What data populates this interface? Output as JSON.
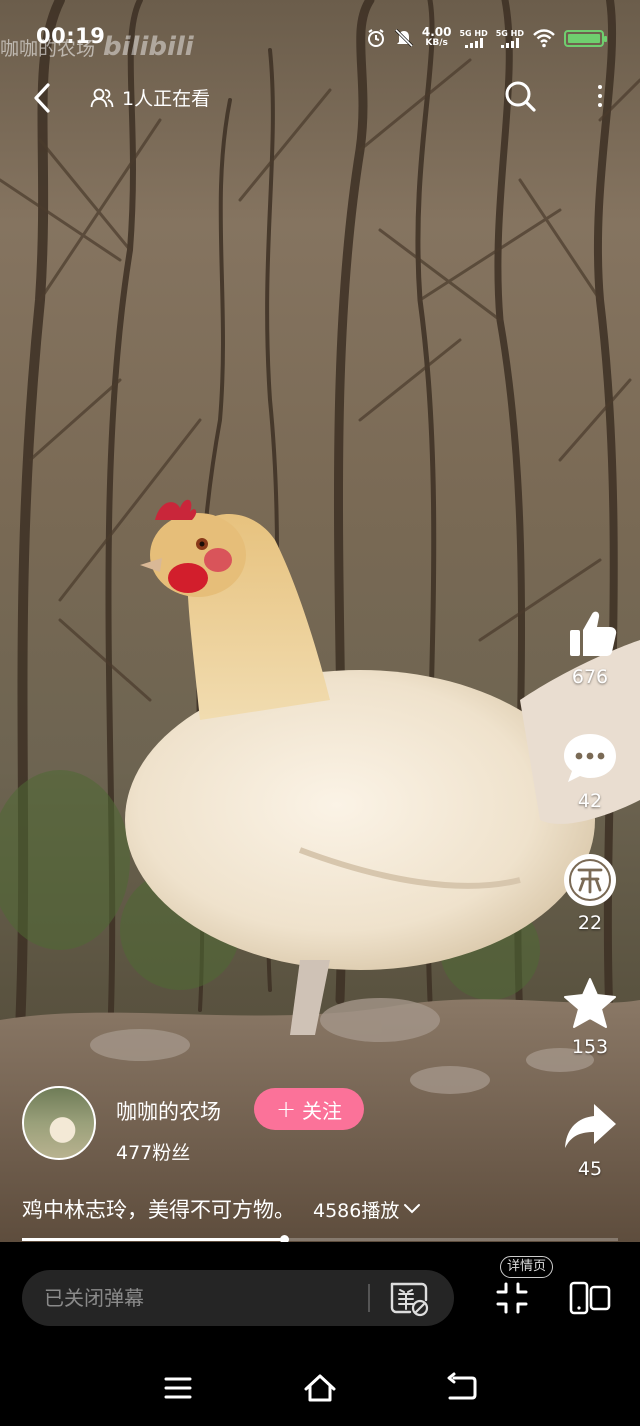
{
  "status_bar": {
    "time": "00:19",
    "watermark_text": "咖咖的农场",
    "watermark_logo": "bilibili",
    "net_speed_value": "4.00",
    "net_speed_unit": "KB/s",
    "signal_1": "5G HD",
    "signal_2": "5G HD",
    "icons": [
      "alarm-icon",
      "mute-icon",
      "wifi-icon",
      "battery-icon"
    ]
  },
  "top_nav": {
    "viewers_text": "1人正在看",
    "icons": [
      "back-icon",
      "viewers-icon",
      "search-icon",
      "more-icon"
    ]
  },
  "actions": {
    "like": {
      "count": "676",
      "icon": "thumbs-up-icon"
    },
    "comment": {
      "count": "42",
      "icon": "comment-icon"
    },
    "coin": {
      "count": "22",
      "icon": "coin-icon"
    },
    "favorite": {
      "count": "153",
      "icon": "star-icon"
    },
    "share": {
      "count": "45",
      "icon": "share-icon"
    }
  },
  "author": {
    "name": "咖咖的农场",
    "fans": "477粉丝",
    "follow_label": "关注"
  },
  "video": {
    "caption": "鸡中林志玲，美得不可方物。",
    "plays": "4586播放",
    "progress": 0.44
  },
  "bottom_bar": {
    "danmaku_placeholder": "已关闭弹幕",
    "detail_label": "详情页"
  },
  "colors": {
    "accent": "#fb7299",
    "battery": "#6fcf6f"
  }
}
